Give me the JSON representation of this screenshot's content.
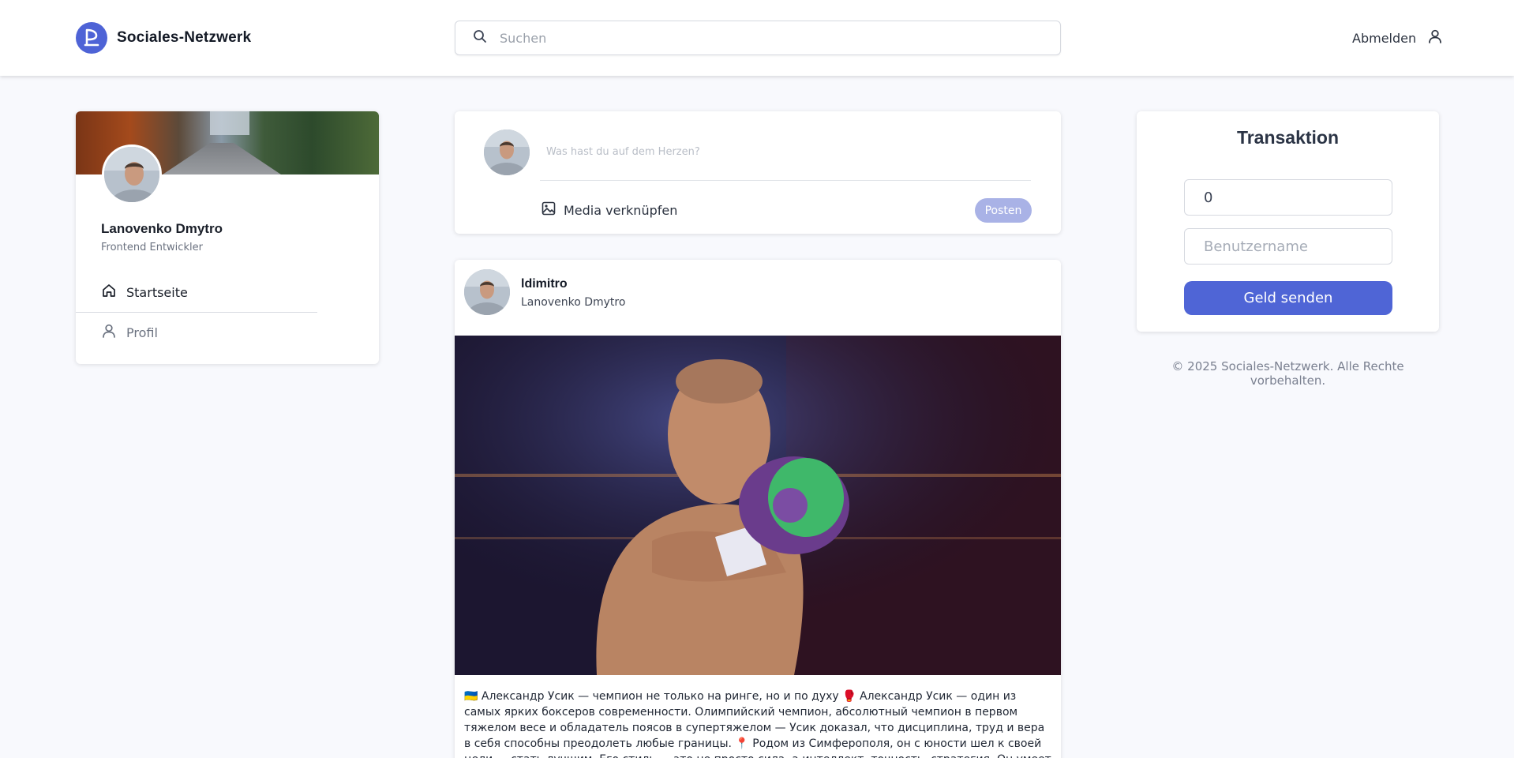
{
  "brand": {
    "name": "Sociales-Netzwerk",
    "accent": "#4e63d6"
  },
  "search": {
    "placeholder": "Suchen"
  },
  "header": {
    "logout_label": "Abmelden"
  },
  "profile": {
    "name": "Lanovenko Dmytro",
    "role": "Frontend Entwickler",
    "nav": [
      {
        "label": "Startseite",
        "icon": "home-icon"
      },
      {
        "label": "Profil",
        "icon": "user-icon"
      }
    ]
  },
  "composer": {
    "placeholder": "Was hast du auf dem Herzen?",
    "media_label": "Media verknüpfen",
    "post_label": "Posten"
  },
  "post": {
    "username": "ldimitro",
    "full_name": "Lanovenko Dmytro",
    "text": "🇺🇦 Александр Усик — чемпион не только на ринге, но и по духу 🥊 Александр Усик — один из самых ярких боксеров современности. Олимпийский чемпион, абсолютный чемпион в первом тяжелом весе и обладатель поясов в супертяжелом — Усик доказал, что дисциплина, труд и вера в себя способны преодолеть любые границы. 📍 Родом из Симферополя, он с юности шел к своей цели — стать лучшим. Его стиль — это не просто сила, а интеллект, точность, стратегия. Он умеет не только бить, но и думать в ринге. 💬 За пределами ринга"
  },
  "transaction": {
    "title": "Transaktion",
    "amount_value": "0",
    "username_placeholder": "Benutzername",
    "send_label": "Geld senden"
  },
  "footer": {
    "copyright": "© 2025 Sociales-Netzwerk. Alle Rechte vorbehalten."
  }
}
